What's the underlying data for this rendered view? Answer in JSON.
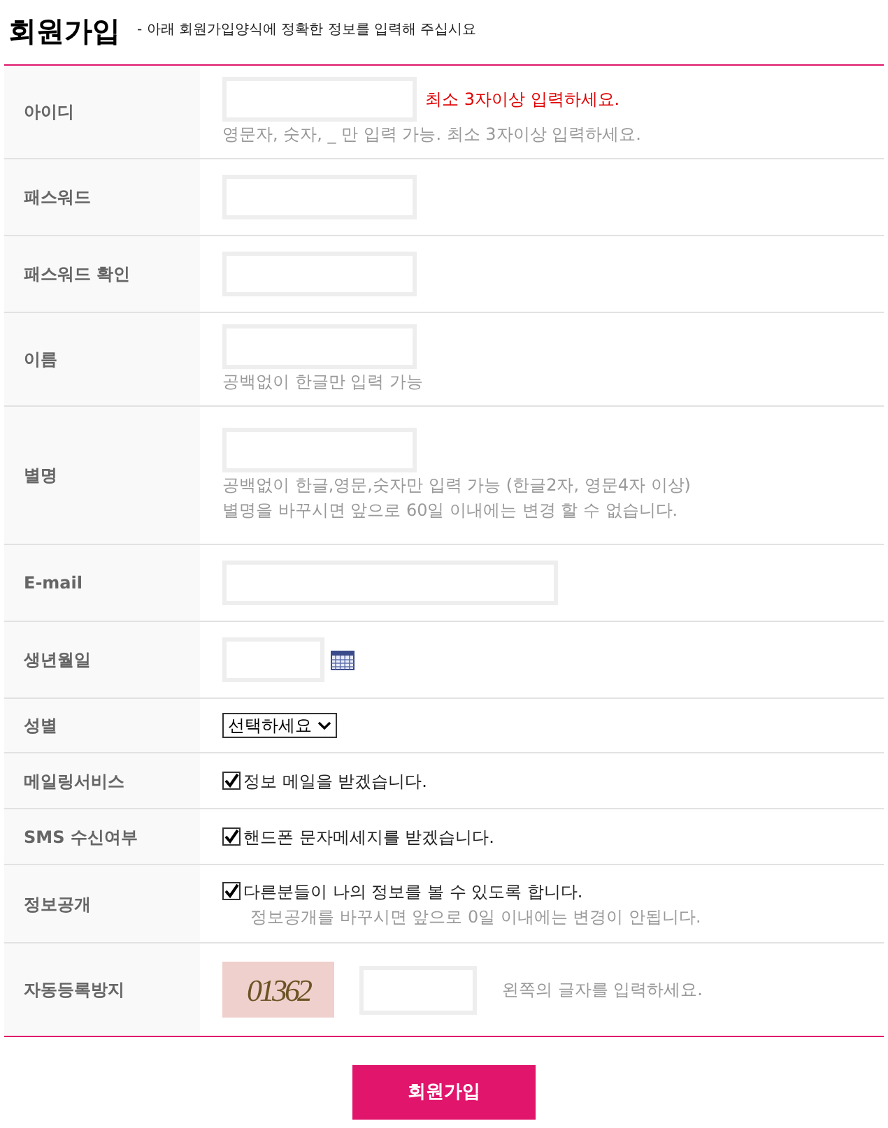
{
  "header": {
    "title": "회원가입",
    "subtitle": "- 아래 회원가입양식에 정확한 정보를 입력해 주십시요"
  },
  "rows": [
    {
      "label": "아이디",
      "kind": "text",
      "error": "최소 3자이상 입력하세요.",
      "hints": [
        "영문자, 숫자, _ 만 입력 가능. 최소 3자이상 입력하세요."
      ]
    },
    {
      "label": "패스워드",
      "kind": "text"
    },
    {
      "label": "패스워드 확인",
      "kind": "text"
    },
    {
      "label": "이름",
      "kind": "text",
      "hints": [
        "공백없이 한글만 입력 가능"
      ]
    },
    {
      "label": "별명",
      "kind": "text",
      "hints": [
        "공백없이 한글,영문,숫자만 입력 가능 (한글2자, 영문4자 이상)",
        "별명을 바꾸시면 앞으로 60일 이내에는 변경 할 수 없습니다."
      ]
    },
    {
      "label": "E-mail",
      "kind": "email"
    },
    {
      "label": "생년월일",
      "kind": "date"
    },
    {
      "label": "성별",
      "kind": "select",
      "value": "선택하세요"
    },
    {
      "label": "메일링서비스",
      "kind": "checkbox",
      "checked": true,
      "text": "정보 메일을 받겠습니다."
    },
    {
      "label": "SMS 수신여부",
      "kind": "checkbox",
      "checked": true,
      "text": "핸드폰 문자메세지를 받겠습니다."
    },
    {
      "label": "정보공개",
      "kind": "checkbox",
      "checked": true,
      "text": "다른분들이 나의 정보를 볼 수 있도록 합니다.",
      "hints": [
        "정보공개를 바꾸시면 앞으로 0일 이내에는 변경이 안됩니다."
      ]
    },
    {
      "label": "자동등록방지",
      "kind": "captcha",
      "code": "01362",
      "text": "왼쪽의 글자를 입력하세요."
    }
  ],
  "submit": "회원가입"
}
